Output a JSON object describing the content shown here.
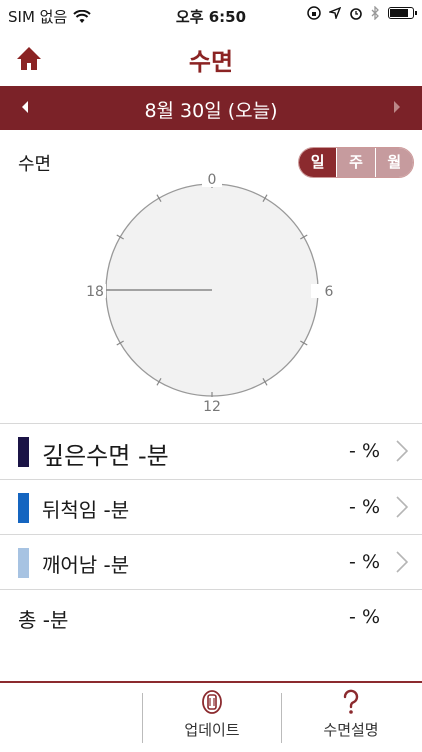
{
  "status_bar": {
    "carrier": "SIM 없음",
    "time": "오후 6:50",
    "battery_level": 0.9
  },
  "nav": {
    "title": "수면"
  },
  "date_bar": {
    "date": "8월 30일 (오늘)"
  },
  "section": {
    "label": "수면"
  },
  "segment": {
    "options": [
      "일",
      "주",
      "월"
    ],
    "selected": "일"
  },
  "clock": {
    "labels": {
      "top": "0",
      "right": "6",
      "bottom": "12",
      "left": "18"
    }
  },
  "rows": [
    {
      "label": "깊은수면  -분",
      "percent": "- %",
      "color": "#1b1446",
      "has_arrow": true
    },
    {
      "label": "뒤척임  -분",
      "percent": "- %",
      "color": "#1565c0",
      "has_arrow": true
    },
    {
      "label": "깨어남  -분",
      "percent": "- %",
      "color": "#a7c3e2",
      "has_arrow": true
    },
    {
      "label": "총 -분",
      "percent": "- %",
      "has_arrow": false
    }
  ],
  "tabbar": {
    "tabs": [
      {
        "label": "업데이트",
        "icon": "band-icon"
      },
      {
        "label": "수면설명",
        "icon": "question-icon"
      }
    ]
  },
  "colors": {
    "accent": "#7b2228",
    "segment_inactive": "#c69b9e"
  }
}
